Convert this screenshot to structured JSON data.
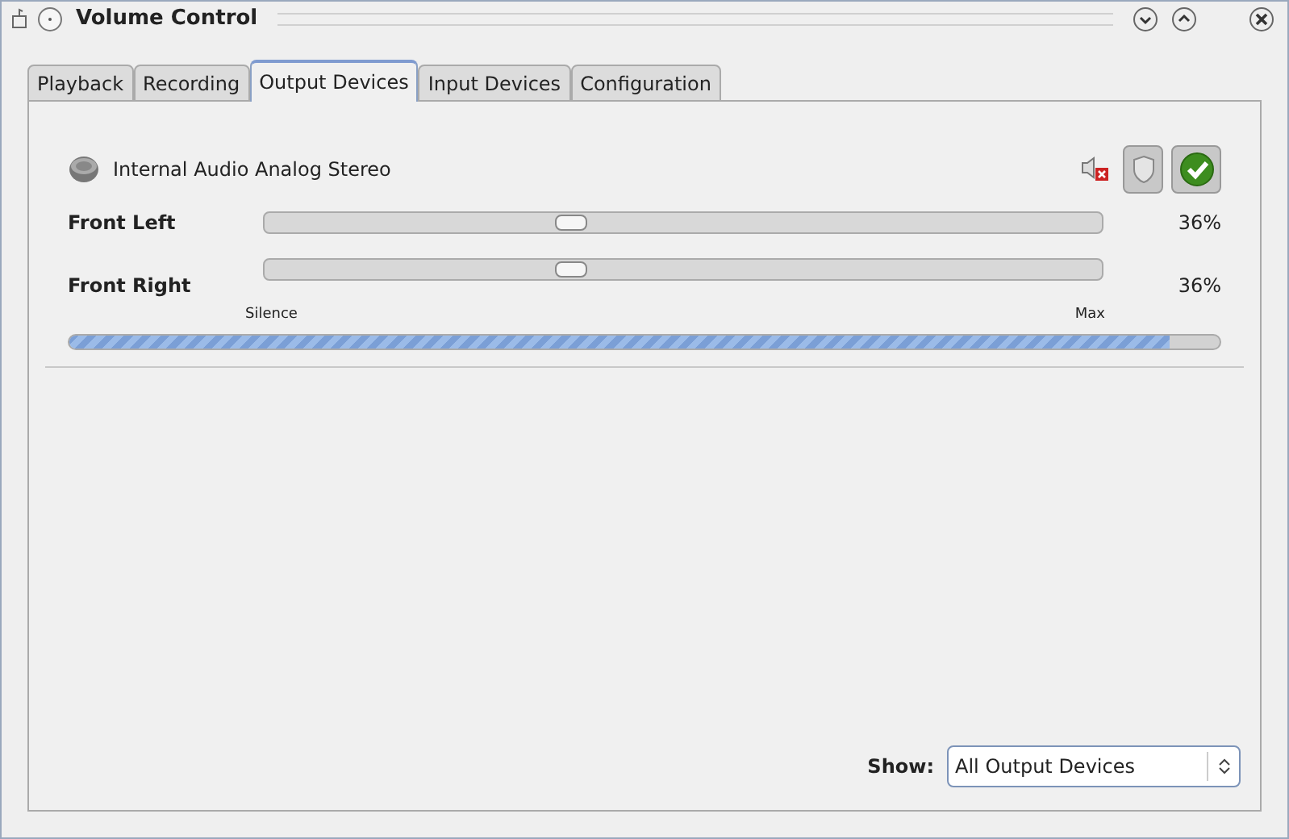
{
  "window": {
    "title": "Volume Control"
  },
  "tabs": [
    {
      "label": "Playback",
      "selected": false
    },
    {
      "label": "Recording",
      "selected": false
    },
    {
      "label": "Output Devices",
      "selected": true
    },
    {
      "label": "Input Devices",
      "selected": false
    },
    {
      "label": "Configuration",
      "selected": false
    }
  ],
  "device": {
    "name": "Internal Audio Analog Stereo",
    "muted": true,
    "lock_channels": true,
    "channels": [
      {
        "name": "Front Left",
        "level": 0.36,
        "reading": "36%"
      },
      {
        "name": "Front Right",
        "level": 0.36,
        "reading": "36%"
      }
    ],
    "scale": [
      "Silence",
      "Max"
    ],
    "peak": {
      "level": 0.957
    }
  },
  "show": {
    "label": "Show:",
    "value": "All Output Devices"
  }
}
